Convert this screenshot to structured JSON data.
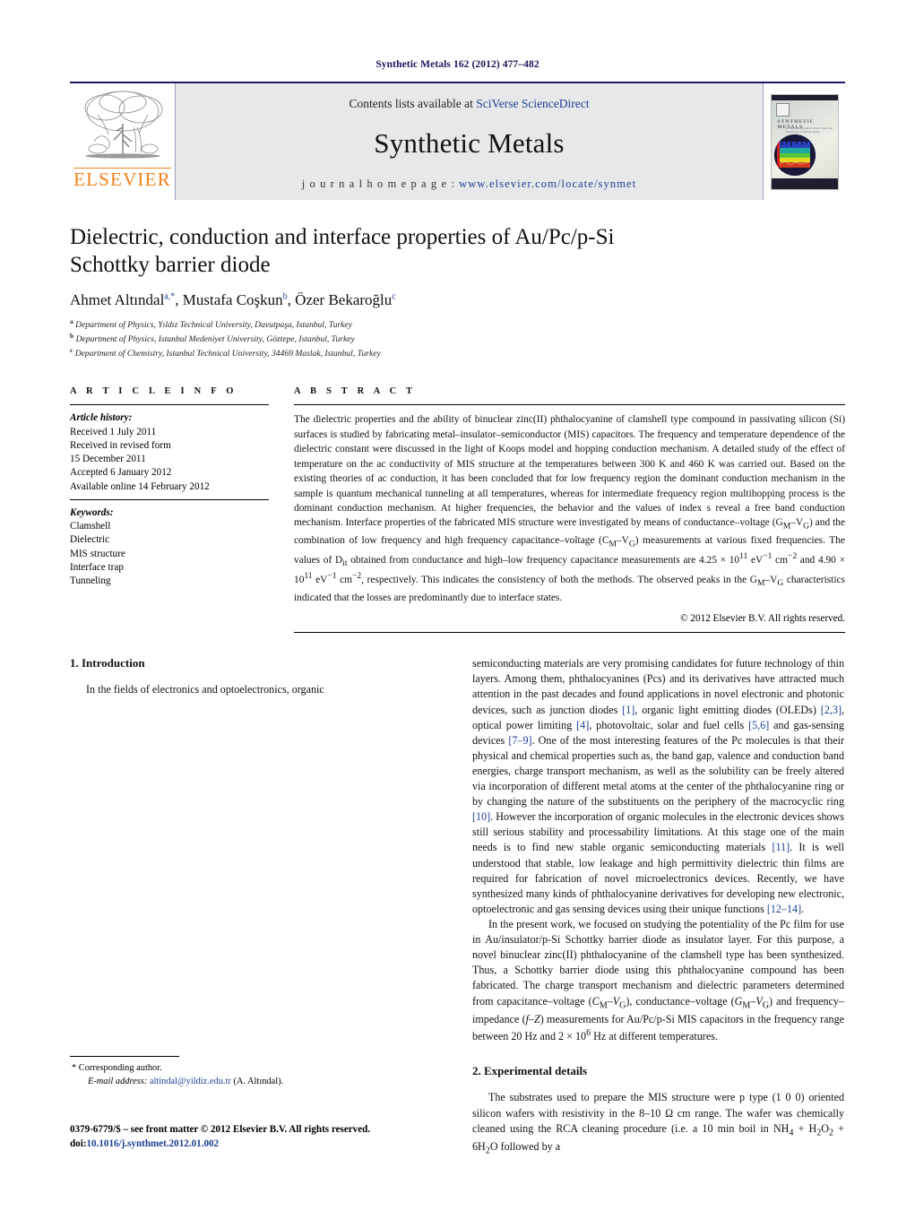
{
  "running_head": "Synthetic Metals 162 (2012) 477–482",
  "masthead": {
    "publisher_name": "ELSEVIER",
    "contents_prefix": "Contents lists available at ",
    "contents_link": "SciVerse ScienceDirect",
    "journal_title": "Synthetic Metals",
    "homepage_label": "j o u r n a l   h o m e p a g e :  ",
    "homepage_url": "www.elsevier.com/locate/synmet",
    "cover_title": "SYNTHETIC   METALS",
    "cover_subtitle": "An International Journal on the Science and Technology of Synthetic Metals"
  },
  "article": {
    "title": "Dielectric, conduction and interface properties of Au/Pc/p-Si Schottky barrier diode",
    "authors_plain": "Ahmet Altındala,*, Mustafa Coşkunb, Özer Bekaroğluc",
    "affiliations": [
      {
        "marker": "a",
        "text": "Department of Physics, Yıldız Technical University, Davutpaşa, Istanbul, Turkey"
      },
      {
        "marker": "b",
        "text": "Department of Physics, Istanbul Medeniyet University, Göztepe, Istanbul, Turkey"
      },
      {
        "marker": "c",
        "text": "Department of Chemistry, Istanbul Technical University, 34469 Maslak, Istanbul, Turkey"
      }
    ]
  },
  "article_info": {
    "heading": "A R T I C L E   I N F O",
    "history_label": "Article history:",
    "history_lines": [
      "Received 1 July 2011",
      "Received in revised form",
      "15 December 2011",
      "Accepted 6 January 2012",
      "Available online 14 February 2012"
    ],
    "keywords_label": "Keywords:",
    "keywords": [
      "Clamshell",
      "Dielectric",
      "MIS structure",
      "Interface trap",
      "Tunneling"
    ]
  },
  "abstract": {
    "heading": "A B S T R A C T",
    "text_html": "The dielectric properties and the ability of binuclear zinc(II) phthalocyanine of clamshell type compound in passivating silicon (Si) surfaces is studied by fabricating metal–insulator–semiconductor (MIS) capacitors. The frequency and temperature dependence of the dielectric constant were discussed in the light of Koops model and hopping conduction mechanism. A detailed study of the effect of temperature on the ac conductivity of MIS structure at the temperatures between 300 K and 460 K was carried out. Based on the existing theories of ac conduction, it has been concluded that for low frequency region the dominant conduction mechanism in the sample is quantum mechanical tunneling at all temperatures, whereas for intermediate frequency region multihopping process is the dominant conduction mechanism. At higher frequencies, the behavior and the values of index s reveal a free band conduction mechanism. Interface properties of the fabricated MIS structure were investigated by means of conductance–voltage (G<sub>M</sub>–V<sub>G</sub>) and the combination of low frequency and high frequency capacitance–voltage (C<sub>M</sub>–V<sub>G</sub>) measurements at various fixed frequencies. The values of D<sub>it</sub> obtained from conductance and high–low frequency capacitance measurements are 4.25 × 10<sup>11</sup> eV<sup>−1</sup> cm<sup>−2</sup> and 4.90 × 10<sup>11</sup> eV<sup>−1</sup> cm<sup>−2</sup>, respectively. This indicates the consistency of both the methods. The observed peaks in the G<sub>M</sub>–V<sub>G</sub> characteristics indicated that the losses are predominantly due to interface states.",
    "copyright": "© 2012 Elsevier B.V. All rights reserved."
  },
  "sections": {
    "introduction_heading": "1.  Introduction",
    "experimental_heading": "2.  Experimental details",
    "intro_p1_html": "In the fields of electronics and optoelectronics, organic semiconducting materials are very promising candidates for future technology of thin layers. Among them, phthalocyanines (Pcs) and its derivatives have attracted much attention in the past decades and found applications in novel electronic and photonic devices, such as junction diodes <span class=\"ref\">[1]</span>, organic light emitting diodes (OLEDs) <span class=\"ref\">[2,3]</span>, optical power limiting <span class=\"ref\">[4]</span>, photovoltaic, solar and fuel cells <span class=\"ref\">[5,6]</span> and gas-sensing devices <span class=\"ref\">[7–9]</span>. One of the most interesting features of the Pc molecules is that their physical and chemical properties such as, the band gap, valence and conduction band energies, charge transport mechanism, as well as the solubility can be freely altered via incorporation of different metal atoms at the center of the phthalocyanine ring or by changing the nature of the substituents on the periphery of the macrocyclic ring <span class=\"ref\">[10]</span>. However the incorporation of organic molecules in the electronic devices shows still serious stability and processability limitations. At this stage one of the main needs is to find new stable organic semiconducting materials <span class=\"ref\">[11]</span>. It is well understood that stable, low leakage and high permittivity dielectric thin films are required for fabrication of novel microelectronics devices. Recently, we have synthesized many kinds of phthalocyanine derivatives for developing new electronic, optoelectronic and gas sensing devices using their unique functions <span class=\"ref\">[12–14]</span>.",
    "intro_p2_html": "In the present work, we focused on studying the potentiality of the Pc film for use in Au/insulator/p-Si Schottky barrier diode as insulator layer. For this purpose, a novel binuclear zinc(II) phthalocyanine of the clamshell type has been synthesized. Thus, a Schottky barrier diode using this phthalocyanine compound has been fabricated. The charge transport mechanism and dielectric parameters determined from capacitance–voltage (<i>C</i><sub>M</sub>–<i>V</i><sub>G</sub>), conductance–voltage (<i>G</i><sub>M</sub>–<i>V</i><sub>G</sub>) and frequency–impedance (<i>f</i>–<i>Z</i>) measurements for Au/Pc/p-Si MIS capacitors in the frequency range between 20 Hz and 2 × 10<sup>6</sup> Hz at different temperatures.",
    "exp_p1_html": "The substrates used to prepare the MIS structure were p type (1 0 0) oriented silicon wafers with resistivity in the 8–10 Ω cm range. The wafer was chemically cleaned using the RCA cleaning procedure (i.e. a 10 min boil in NH<sub>4</sub> + H<sub>2</sub>O<sub>2</sub> + 6H<sub>2</sub>O followed by a"
  },
  "footnote": {
    "corresponding": "* Corresponding author.",
    "email_label": "E-mail address:",
    "email": "altindal@yildiz.edu.tr",
    "email_owner": "(A. Altındal)."
  },
  "imprint": {
    "line1": "0379-6779/$ – see front matter © 2012 Elsevier B.V. All rights reserved.",
    "doi_label": "doi:",
    "doi_value": "10.1016/j.synthmet.2012.01.002"
  },
  "colors": {
    "link": "#1c3f94",
    "running_head": "#17175c",
    "elsevier_orange": "#f08019",
    "band_gray": "#e7e8ea"
  }
}
